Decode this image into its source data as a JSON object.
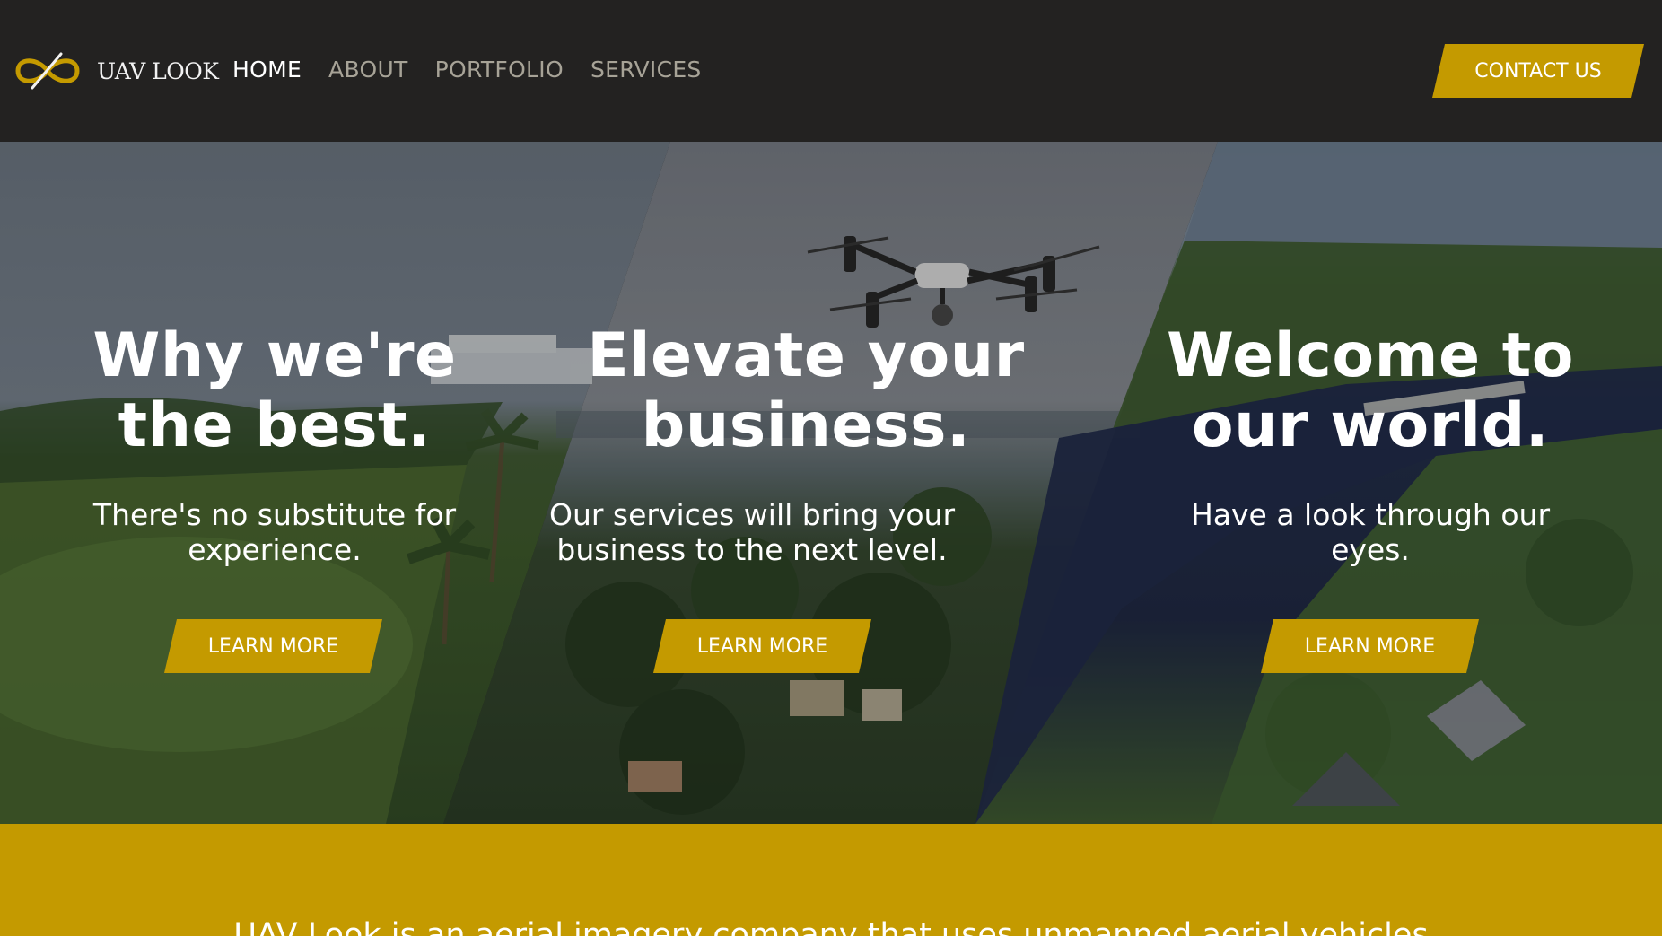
{
  "brand": {
    "name": "UAV LOOK",
    "logo_icon": "infinity-drone-logo-icon",
    "accent_color": "#c49a00"
  },
  "nav": {
    "items": [
      {
        "label": "HOME",
        "active": true
      },
      {
        "label": "ABOUT",
        "active": false
      },
      {
        "label": "PORTFOLIO",
        "active": false
      },
      {
        "label": "SERVICES",
        "active": false
      }
    ],
    "contact_label": "CONTACT US"
  },
  "hero": {
    "slides": [
      {
        "title_line1": "Why we're",
        "title_line2": "the best.",
        "text_line1": "There's no substitute for",
        "text_line2": "experience.",
        "button": "LEARN MORE"
      },
      {
        "title_line1": "Elevate your",
        "title_line2": "business.",
        "text_line1": "Our services will bring your",
        "text_line2": "business to the next level.",
        "button": "LEARN MORE"
      },
      {
        "title_line1": "Welcome to",
        "title_line2": "our world.",
        "text_line1": "Have a look through our",
        "text_line2": "eyes.",
        "button": "LEARN MORE"
      }
    ]
  },
  "intro": {
    "text": "UAV Look is an aerial imagery company that uses unmanned aerial vehicles"
  }
}
